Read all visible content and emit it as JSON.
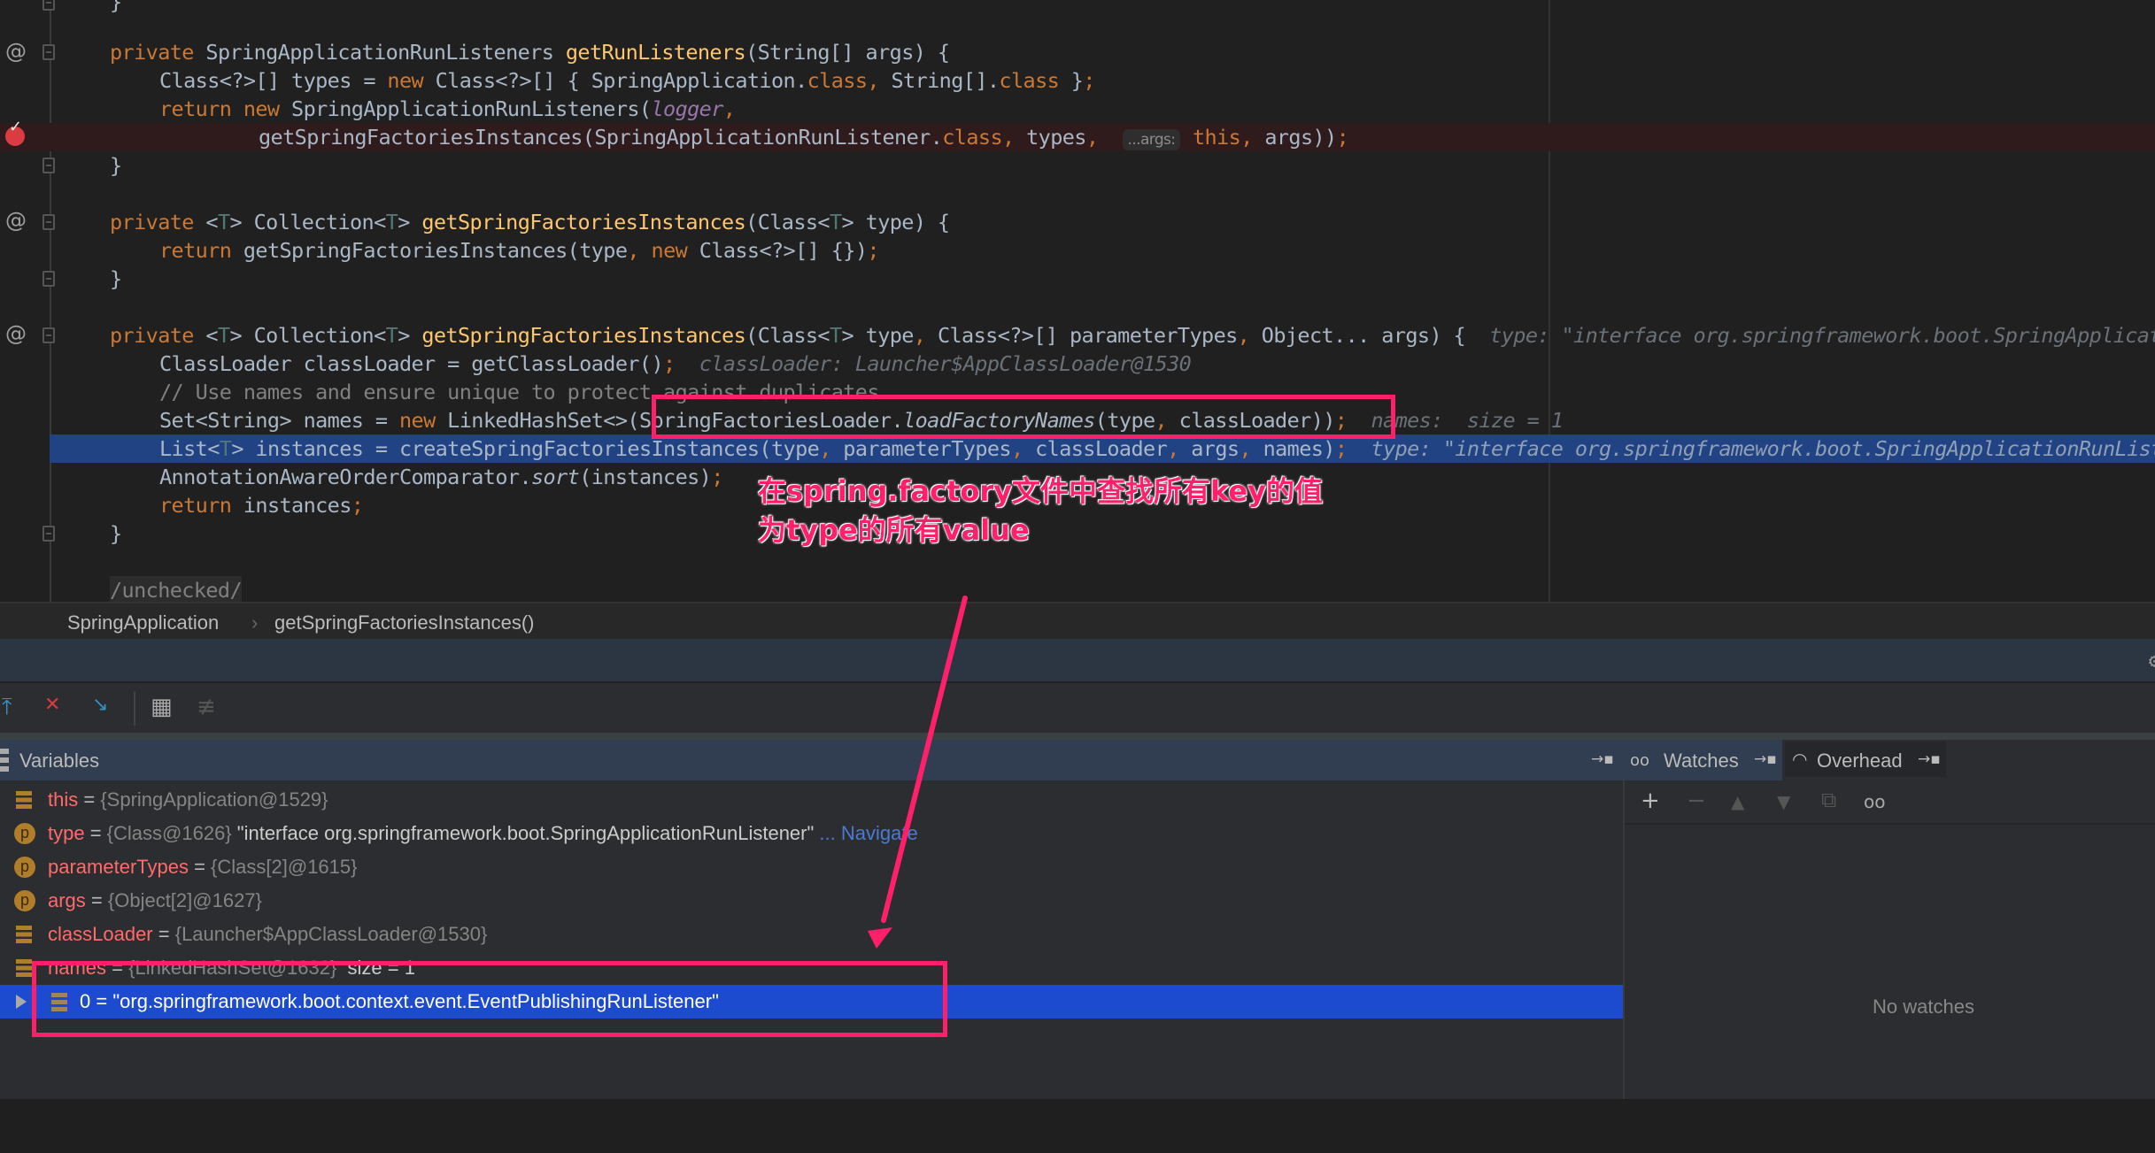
{
  "editor": {
    "lines": [
      {
        "text": "}"
      },
      {
        "text": ""
      },
      {
        "text": "private SpringApplicationRunListeners getRunListeners(String[] args) {"
      },
      {
        "text": "Class<?>[] types = new Class<?>[] { SpringApplication.class, String[].class };"
      },
      {
        "text": "return new SpringApplicationRunListeners(logger,"
      },
      {
        "text": "getSpringFactoriesInstances(SpringApplicationRunListener.class, types, ",
        "hint_chip": "...args:",
        "rest": "this, args));"
      },
      {
        "text": "}"
      },
      {
        "text": ""
      },
      {
        "text": "private <T> Collection<T> getSpringFactoriesInstances(Class<T> type) {"
      },
      {
        "text": "return getSpringFactoriesInstances(type, new Class<?>[] {});"
      },
      {
        "text": "}"
      },
      {
        "text": ""
      },
      {
        "text": "private <T> Collection<T> getSpringFactoriesInstances(Class<T> type, Class<?>[] parameterTypes, Object... args) {",
        "hint": "type: \"interface org.springframework.boot.SpringApplicationRunListener\""
      },
      {
        "text": "ClassLoader classLoader = getClassLoader();",
        "hint": "classLoader: Launcher$AppClassLoader@1530"
      },
      {
        "text": "// Use names and ensure unique to protect against duplicates"
      },
      {
        "text": "Set<String> names = new LinkedHashSet<>(SpringFactoriesLoader.loadFactoryNames(type, classLoader));",
        "hint": "names:  size = 1"
      },
      {
        "text": "List<T> instances = createSpringFactoriesInstances(type, parameterTypes, classLoader, args, names);",
        "hint": "type: \"interface org.springframework.boot.SpringApplicationRunListener\""
      },
      {
        "text": "AnnotationAwareOrderComparator.sort(instances);"
      },
      {
        "text": "return instances;"
      },
      {
        "text": "}"
      },
      {
        "text": ""
      },
      {
        "text": "/unchecked/"
      }
    ]
  },
  "breadcrumb": {
    "items": [
      "SpringApplication",
      "getSpringFactoriesInstances()"
    ],
    "separator": "›"
  },
  "debug": {
    "toolbar": {
      "icons": [
        "step-out-icon",
        "drop-frame-icon",
        "run-to-cursor-icon",
        "evaluate-expression-icon",
        "trace-icon"
      ]
    },
    "variables": {
      "title": "Variables",
      "pin_glyph": "→▪",
      "rows": [
        {
          "icon": "field",
          "name": "this",
          "value": "{SpringApplication@1529}"
        },
        {
          "icon": "param",
          "name": "type",
          "value": "{Class@1626}",
          "extra": "\"interface org.springframework.boot.SpringApplicationRunListener\"",
          "link": "... Navigate"
        },
        {
          "icon": "param",
          "name": "parameterTypes",
          "value": "{Class[2]@1615}"
        },
        {
          "icon": "param",
          "name": "args",
          "value": "{Object[2]@1627}"
        },
        {
          "icon": "field",
          "name": "classLoader",
          "value": "{Launcher$AppClassLoader@1530}"
        },
        {
          "icon": "field",
          "name": "names",
          "value": "{LinkedHashSet@1632}",
          "extra": "size = 1"
        }
      ],
      "selected_child": {
        "index": "0",
        "value": "\"org.springframework.boot.context.event.EventPublishingRunListener\""
      }
    },
    "tabs": [
      {
        "label": "Watches",
        "icon": "glasses-icon"
      },
      {
        "label": "Overhead",
        "icon": "gauge-icon"
      }
    ],
    "watches": {
      "tools": [
        "+",
        "−",
        "▲",
        "▼",
        "⧉",
        "oo"
      ],
      "empty_text": "No watches"
    }
  },
  "annotation": {
    "line1": "在spring.factory文件中查找所有key的值",
    "line2": "为type的所有value",
    "color": "#ff1f6a"
  },
  "colors": {
    "keyword": "#cc7832",
    "method": "#ffc66d",
    "selection": "#1d4bd0",
    "exec_line": "#214283"
  }
}
